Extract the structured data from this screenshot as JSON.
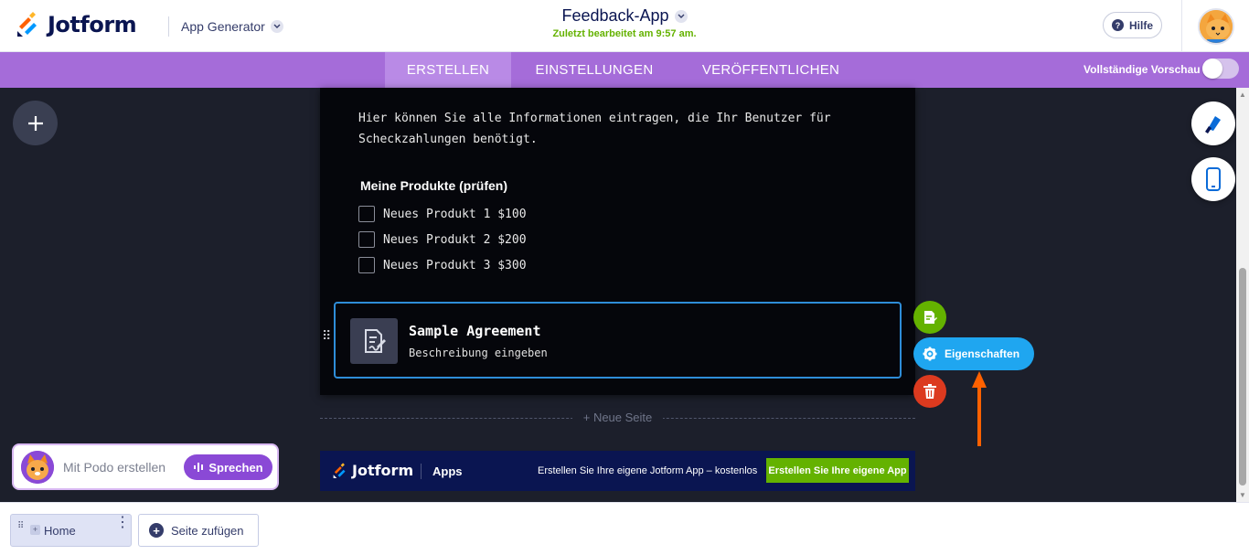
{
  "header": {
    "logo_text": "Jotform",
    "app_generator": "App Generator",
    "app_title": "Feedback-App",
    "last_edited": "Zuletzt bearbeitet am 9:57 am.",
    "help_label": "Hilfe"
  },
  "nav": {
    "tabs": [
      {
        "label": "ERSTELLEN",
        "active": true
      },
      {
        "label": "EINSTELLUNGEN",
        "active": false
      },
      {
        "label": "VERÖFFENTLICHEN",
        "active": false
      }
    ],
    "preview_label": "Vollständige Vorschau",
    "preview_enabled": false
  },
  "form": {
    "intro_text": "Hier können Sie alle Informationen eintragen, die Ihr Benutzer für Scheckzahlungen benötigt.",
    "products_label": "Meine Produkte (prüfen)",
    "products": [
      {
        "label": "Neues Produkt 1 $100",
        "checked": false
      },
      {
        "label": "Neues Produkt 2 $200",
        "checked": false
      },
      {
        "label": "Neues Produkt 3 $300",
        "checked": false
      }
    ],
    "agreement": {
      "title": "Sample Agreement",
      "description": "Beschreibung eingeben"
    }
  },
  "element_actions": {
    "properties_label": "Eigenschaften"
  },
  "new_page_label": "+ Neue Seite",
  "footer_banner": {
    "logo_text": "Jotform",
    "apps_label": "Apps",
    "text": "Erstellen Sie Ihre eigene Jotform App – kostenlos",
    "cta_label": "Erstellen Sie Ihre eigene App"
  },
  "podo": {
    "text": "Mit Podo erstellen",
    "speak_label": "Sprechen"
  },
  "bottom": {
    "pages": [
      {
        "label": "Home"
      }
    ],
    "add_page_label": "Seite zufügen"
  },
  "colors": {
    "nav_purple": "#a56cd9",
    "canvas_bg": "#1c1f2b",
    "selected_border": "#2e8dd8",
    "properties_blue": "#1fa6f0",
    "duplicate_green": "#64b200",
    "delete_red": "#dc3a1f",
    "annotation_arrow": "#ff6100"
  }
}
